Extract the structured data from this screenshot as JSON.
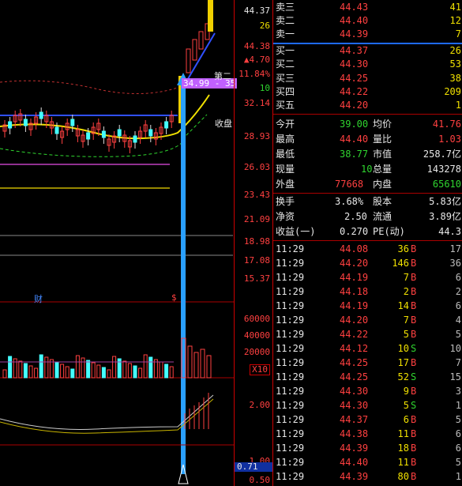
{
  "price_axis": [
    "44.37",
    "26",
    "44.38",
    "▲4.70",
    "11.84%",
    "10",
    "32.14",
    "28.93",
    "26.03",
    "23.43",
    "21.09",
    "18.98",
    "17.08",
    "15.37"
  ],
  "volume_axis": [
    "60000",
    "40000",
    "20000",
    "X10"
  ],
  "indicator_axis": [
    "2.00",
    "1.00",
    "0.71",
    "0.50"
  ],
  "chart_labels": {
    "annotation_price": "34.99 - 35",
    "annotation_tag": "第二",
    "close_line_label": "收盘",
    "finance_marker": "财",
    "dollar_marker": "$"
  },
  "order_book": {
    "sell": [
      {
        "label": "卖三",
        "price": "44.43",
        "vol": "41"
      },
      {
        "label": "卖二",
        "price": "44.40",
        "vol": "12"
      },
      {
        "label": "卖一",
        "price": "44.39",
        "vol": "7"
      }
    ],
    "buy": [
      {
        "label": "买一",
        "price": "44.37",
        "vol": "26"
      },
      {
        "label": "买二",
        "price": "44.30",
        "vol": "53"
      },
      {
        "label": "买三",
        "price": "44.25",
        "vol": "38"
      },
      {
        "label": "买四",
        "price": "44.22",
        "vol": "209"
      },
      {
        "label": "买五",
        "price": "44.20",
        "vol": "1"
      }
    ]
  },
  "quote": {
    "open_label": "今开",
    "open": "39.00",
    "avg_label": "均价",
    "avg": "41.76",
    "high_label": "最高",
    "high": "44.40",
    "ratio_label": "量比",
    "ratio": "1.03",
    "low_label": "最低",
    "low": "38.77",
    "mcap_label": "市值",
    "mcap": "258.7亿",
    "now_vol_label": "现量",
    "now_vol": "10",
    "total_label": "总量",
    "total": "143278",
    "outer_label": "外盘",
    "outer": "77668",
    "inner_label": "内盘",
    "inner": "65610"
  },
  "stats": {
    "turnover_label": "换手",
    "turnover": "3.68%",
    "equity_label": "股本",
    "equity": "5.83亿",
    "nav_label": "净资",
    "nav": "2.50",
    "float_label": "流通",
    "float": "3.89亿",
    "eps_label": "收益(一)",
    "eps": "0.270",
    "pe_label": "PE(动)",
    "pe": "44.3"
  },
  "trades": [
    {
      "time": "11:29",
      "price": "44.08",
      "vol": "36",
      "side": "B",
      "extra": "17"
    },
    {
      "time": "11:29",
      "price": "44.20",
      "vol": "146",
      "side": "B",
      "extra": "36"
    },
    {
      "time": "11:29",
      "price": "44.19",
      "vol": "7",
      "side": "B",
      "extra": "6"
    },
    {
      "time": "11:29",
      "price": "44.18",
      "vol": "2",
      "side": "B",
      "extra": "2"
    },
    {
      "time": "11:29",
      "price": "44.19",
      "vol": "14",
      "side": "B",
      "extra": "6"
    },
    {
      "time": "11:29",
      "price": "44.20",
      "vol": "7",
      "side": "B",
      "extra": "4"
    },
    {
      "time": "11:29",
      "price": "44.22",
      "vol": "5",
      "side": "B",
      "extra": "5"
    },
    {
      "time": "11:29",
      "price": "44.12",
      "vol": "10",
      "side": "S",
      "extra": "10"
    },
    {
      "time": "11:29",
      "price": "44.25",
      "vol": "17",
      "side": "B",
      "extra": "7"
    },
    {
      "time": "11:29",
      "price": "44.25",
      "vol": "52",
      "side": "S",
      "extra": "15"
    },
    {
      "time": "11:29",
      "price": "44.30",
      "vol": "9",
      "side": "B",
      "extra": "3"
    },
    {
      "time": "11:29",
      "price": "44.30",
      "vol": "5",
      "side": "S",
      "extra": "1"
    },
    {
      "time": "11:29",
      "price": "44.37",
      "vol": "6",
      "side": "B",
      "extra": "5"
    },
    {
      "time": "11:29",
      "price": "44.38",
      "vol": "11",
      "side": "B",
      "extra": "6"
    },
    {
      "time": "11:29",
      "price": "44.39",
      "vol": "18",
      "side": "B",
      "extra": "6"
    },
    {
      "time": "11:29",
      "price": "44.40",
      "vol": "11",
      "side": "B",
      "extra": "5"
    },
    {
      "time": "11:29",
      "price": "44.39",
      "vol": "80",
      "side": "B",
      "extra": "1"
    }
  ],
  "colors": {
    "up": "#ff4040",
    "down": "#2fd52f",
    "accent": "#1e90ff",
    "ma": "#f0e000"
  }
}
